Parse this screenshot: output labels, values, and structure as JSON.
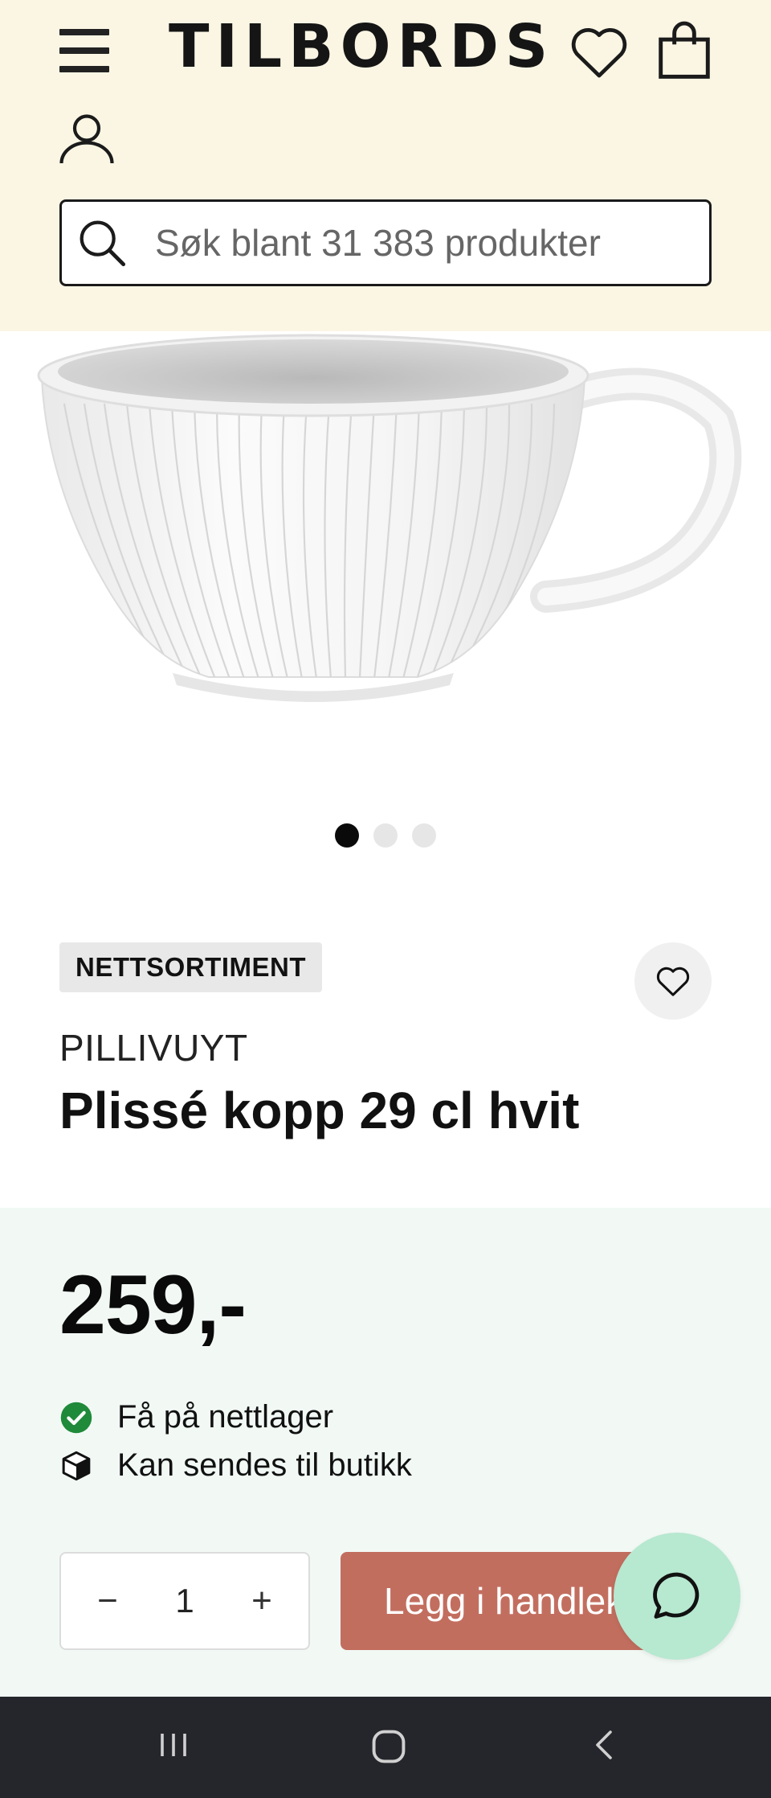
{
  "header": {
    "logo": "TILBORDS",
    "search": {
      "placeholder": "Søk blant 31 383 produkter"
    },
    "icons": [
      "menu-icon",
      "heart-icon",
      "shopping-bag-icon",
      "user-icon",
      "search-icon"
    ]
  },
  "gallery": {
    "image_alt": "white fluted cup",
    "slide_count": 3,
    "active_slide": 1
  },
  "product": {
    "badge": "NETTSORTIMENT",
    "brand": "PILLIVUYT",
    "title": "Plissé kopp 29 cl hvit"
  },
  "purchase": {
    "price": "259,-",
    "availability": [
      {
        "icon": "check-circle-icon",
        "text": "Få på nettlager"
      },
      {
        "icon": "box-icon",
        "text": "Kan sendes til butikk"
      }
    ],
    "quantity": "1",
    "minus": "−",
    "plus": "+",
    "add_to_cart": "Legg i handlekurv"
  },
  "colors": {
    "header_bg": "#fbf6e4",
    "price_bg": "#f2f9f5",
    "cta": "#c26e5f",
    "chat": "#b7e8d0",
    "check": "#1f8a3a",
    "navbar": "#25262b"
  }
}
